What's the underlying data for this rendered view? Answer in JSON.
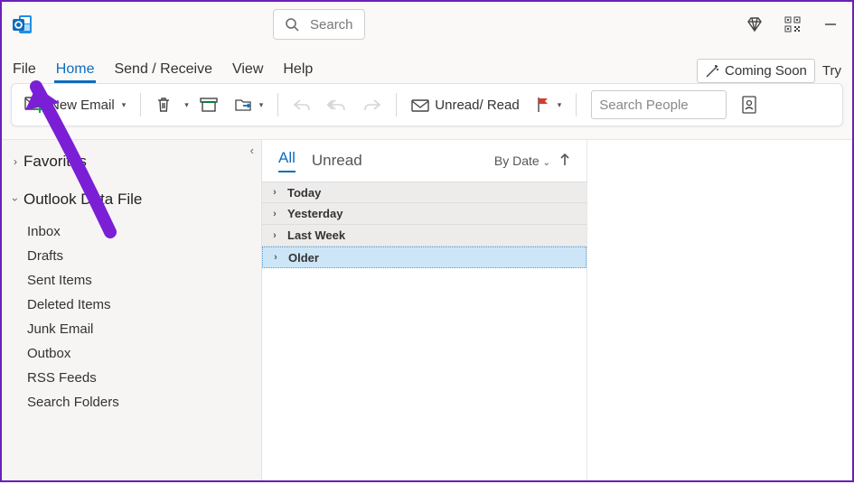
{
  "titlebar": {
    "search_placeholder": "Search"
  },
  "menu": {
    "tabs": [
      "File",
      "Home",
      "Send / Receive",
      "View",
      "Help"
    ],
    "active": 1,
    "coming_soon": "Coming Soon",
    "try": "Try"
  },
  "ribbon": {
    "new_email": "New Email",
    "unread_read": "Unread/ Read",
    "search_people_placeholder": "Search People"
  },
  "sidebar": {
    "favorites": "Favorites",
    "data_file": "Outlook Data File",
    "folders": [
      "Inbox",
      "Drafts",
      "Sent Items",
      "Deleted Items",
      "Junk Email",
      "Outbox",
      "RSS Feeds",
      "Search Folders"
    ]
  },
  "list": {
    "tabs": [
      "All",
      "Unread"
    ],
    "active": 0,
    "sort_label": "By Date",
    "groups": [
      "Today",
      "Yesterday",
      "Last Week",
      "Older"
    ],
    "selected": 3
  }
}
